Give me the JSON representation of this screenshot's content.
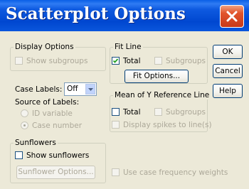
{
  "window": {
    "title": "Scatterplot Options"
  },
  "buttons": {
    "ok": "OK",
    "cancel": "Cancel",
    "help": "Help"
  },
  "display_options": {
    "legend": "Display Options",
    "show_subgroups": {
      "label": "Show subgroups",
      "checked": false,
      "enabled": false
    }
  },
  "case_labels": {
    "label": "Case Labels:",
    "value": "Off",
    "source_label": "Source of Labels:",
    "id_variable": "ID variable",
    "case_number": "Case number"
  },
  "fit_line": {
    "legend": "Fit Line",
    "total": {
      "label": "Total",
      "checked": true
    },
    "subgroups": {
      "label": "Subgroups",
      "checked": false,
      "enabled": false
    },
    "fit_options_button": "Fit Options..."
  },
  "mean_y": {
    "legend": "Mean of Y Reference Line",
    "total": {
      "label": "Total",
      "checked": false
    },
    "subgroups": {
      "label": "Subgroups",
      "checked": false,
      "enabled": false
    },
    "spikes": {
      "label": "Display spikes to line(s)",
      "checked": false,
      "enabled": false
    }
  },
  "sunflowers": {
    "legend": "Sunflowers",
    "show": {
      "label": "Show sunflowers",
      "checked": false
    },
    "options_button": "Sunflower Options..."
  },
  "weights": {
    "label": "Use case frequency weights",
    "checked": false,
    "enabled": false
  },
  "icons": {
    "close": "close-icon",
    "check": "check-icon",
    "dropdown": "chevron-down-icon"
  },
  "colors": {
    "titlebar": "#0a5fe6",
    "close": "#e2542b",
    "face": "#ece9d8",
    "disabled_text": "#aca899"
  }
}
